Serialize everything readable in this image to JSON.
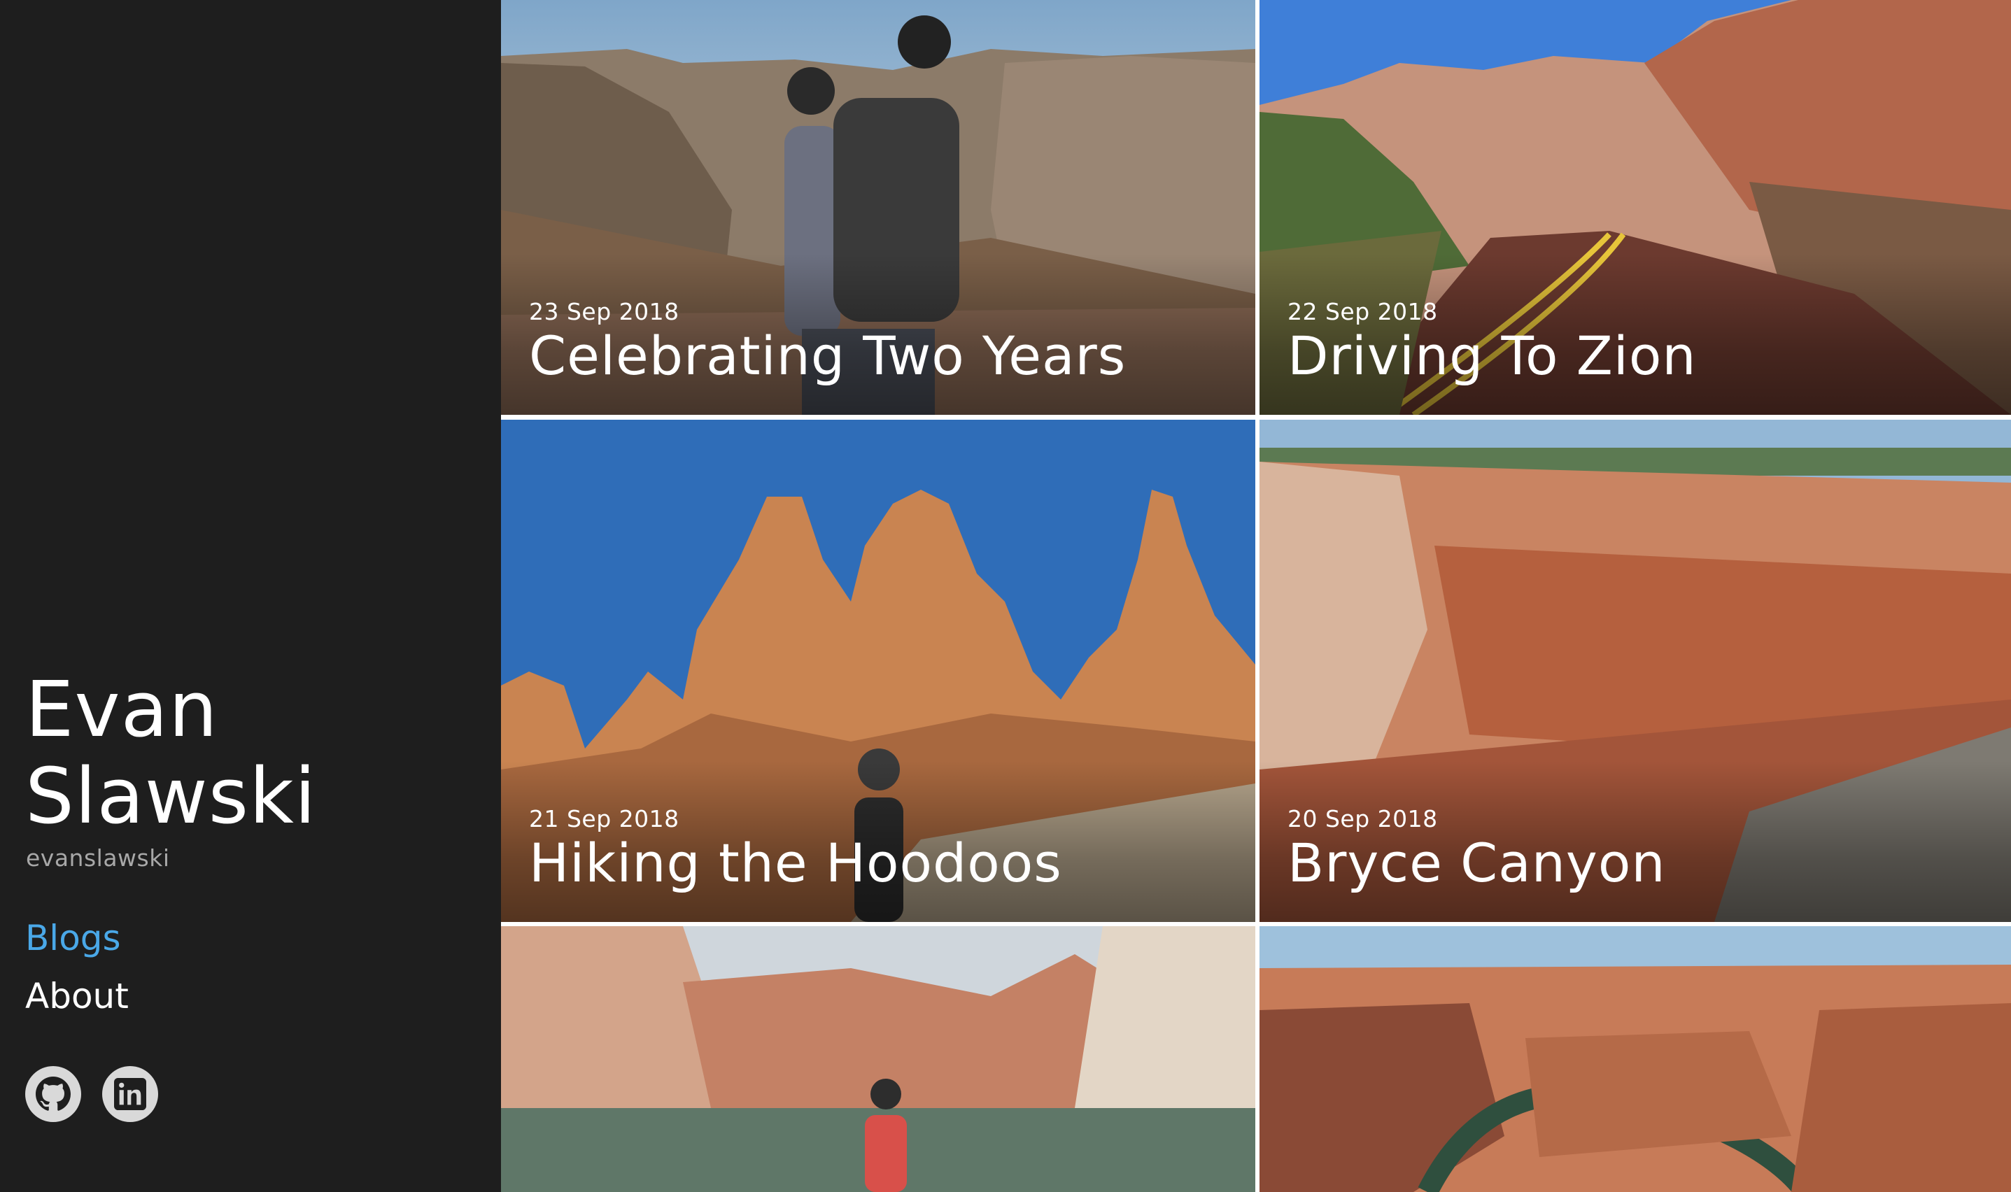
{
  "sidebar": {
    "name_first": "Evan",
    "name_last": "Slawski",
    "handle": "evanslawski",
    "nav": [
      {
        "label": "Blogs",
        "active": true
      },
      {
        "label": "About",
        "active": false
      }
    ],
    "socials": [
      {
        "icon": "github-icon"
      },
      {
        "icon": "linkedin-icon"
      }
    ]
  },
  "posts": [
    {
      "date": "23 Sep 2018",
      "title": "Celebrating Two Years"
    },
    {
      "date": "22 Sep 2018",
      "title": "Driving To Zion"
    },
    {
      "date": "21 Sep 2018",
      "title": "Hiking the Hoodoos"
    },
    {
      "date": "20 Sep 2018",
      "title": "Bryce Canyon"
    },
    {
      "date": "",
      "title": ""
    },
    {
      "date": "",
      "title": ""
    }
  ],
  "colors": {
    "sidebar_bg": "#1e1e1e",
    "active_link": "#4aa8e8",
    "handle_text": "#a8a8a8"
  }
}
